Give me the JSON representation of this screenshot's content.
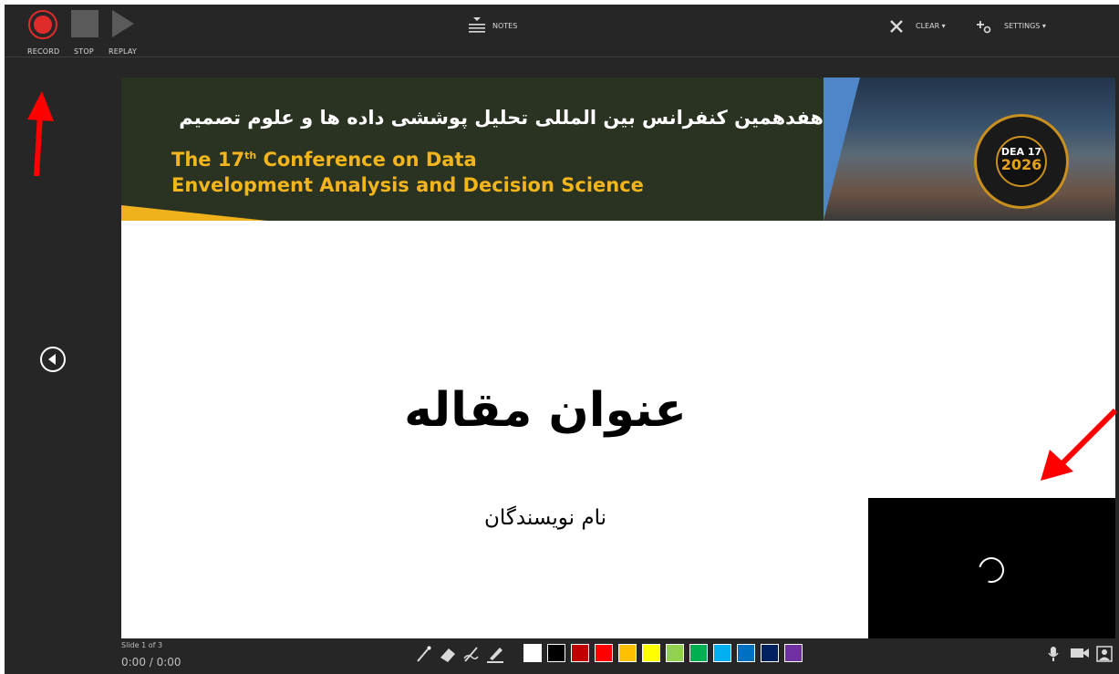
{
  "toolbar": {
    "record_label": "RECORD",
    "stop_label": "STOP",
    "replay_label": "REPLAY",
    "notes_label": "NOTES",
    "clear_label": "CLEAR ▾",
    "settings_label": "SETTINGS ▾"
  },
  "slide": {
    "banner_title_fa": "هفدهمین کنفرانس بین المللی تحلیل پوششی داده ها و علوم تصمیم",
    "banner_title_en_line1_pre": "The 17",
    "banner_title_en_line1_sup": "th",
    "banner_title_en_line1_post": " Conference on Data",
    "banner_title_en_line2": "Envelopment Analysis and Decision Science",
    "seal_line1": "DEA 17",
    "seal_line2": "2026",
    "title": "عنوان مقاله",
    "subtitle": "نام نویسندگان"
  },
  "status": {
    "slide_counter": "Slide 1 of 3",
    "time": "0:00 / 0:00"
  },
  "pen_colors": [
    "#ffffff",
    "#000000",
    "#c00000",
    "#ff0000",
    "#ffc000",
    "#ffff00",
    "#92d050",
    "#00b050",
    "#00b0f0",
    "#0070c0",
    "#002060",
    "#7030a0"
  ],
  "icons": {
    "record": "record-icon",
    "stop": "stop-icon",
    "replay": "replay-icon",
    "notes": "notes-icon",
    "clear": "close-icon",
    "settings": "settings-icon",
    "prev": "chevron-left-icon",
    "mic": "microphone-icon",
    "camera": "camera-icon",
    "preview": "camera-preview-icon"
  },
  "accent_colors": {
    "record_red": "#e02b2b",
    "annotation_arrow": "#ff0000",
    "banner_gold": "#f2b51d"
  }
}
